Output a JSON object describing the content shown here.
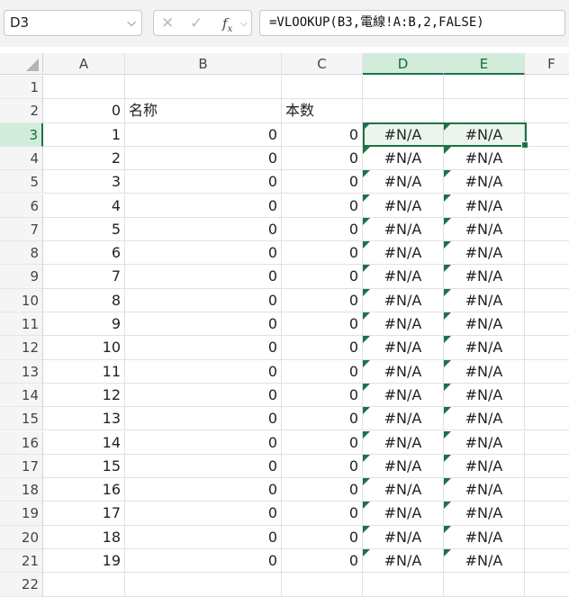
{
  "name_box": "D3",
  "formula": "=VLOOKUP(B3,電線!A:B,2,FALSE)",
  "columns": [
    "A",
    "B",
    "C",
    "D",
    "E",
    "F"
  ],
  "rows": [
    {
      "num": "1",
      "a": "",
      "b": "",
      "c": "",
      "d": "",
      "e": ""
    },
    {
      "num": "2",
      "a": "0",
      "b": "名称",
      "c": "本数",
      "d": "",
      "e": ""
    },
    {
      "num": "3",
      "a": "1",
      "b": "0",
      "c": "0",
      "d": "#N/A",
      "e": "#N/A"
    },
    {
      "num": "4",
      "a": "2",
      "b": "0",
      "c": "0",
      "d": "#N/A",
      "e": "#N/A"
    },
    {
      "num": "5",
      "a": "3",
      "b": "0",
      "c": "0",
      "d": "#N/A",
      "e": "#N/A"
    },
    {
      "num": "6",
      "a": "4",
      "b": "0",
      "c": "0",
      "d": "#N/A",
      "e": "#N/A"
    },
    {
      "num": "7",
      "a": "5",
      "b": "0",
      "c": "0",
      "d": "#N/A",
      "e": "#N/A"
    },
    {
      "num": "8",
      "a": "6",
      "b": "0",
      "c": "0",
      "d": "#N/A",
      "e": "#N/A"
    },
    {
      "num": "9",
      "a": "7",
      "b": "0",
      "c": "0",
      "d": "#N/A",
      "e": "#N/A"
    },
    {
      "num": "10",
      "a": "8",
      "b": "0",
      "c": "0",
      "d": "#N/A",
      "e": "#N/A"
    },
    {
      "num": "11",
      "a": "9",
      "b": "0",
      "c": "0",
      "d": "#N/A",
      "e": "#N/A"
    },
    {
      "num": "12",
      "a": "10",
      "b": "0",
      "c": "0",
      "d": "#N/A",
      "e": "#N/A"
    },
    {
      "num": "13",
      "a": "11",
      "b": "0",
      "c": "0",
      "d": "#N/A",
      "e": "#N/A"
    },
    {
      "num": "14",
      "a": "12",
      "b": "0",
      "c": "0",
      "d": "#N/A",
      "e": "#N/A"
    },
    {
      "num": "15",
      "a": "13",
      "b": "0",
      "c": "0",
      "d": "#N/A",
      "e": "#N/A"
    },
    {
      "num": "16",
      "a": "14",
      "b": "0",
      "c": "0",
      "d": "#N/A",
      "e": "#N/A"
    },
    {
      "num": "17",
      "a": "15",
      "b": "0",
      "c": "0",
      "d": "#N/A",
      "e": "#N/A"
    },
    {
      "num": "18",
      "a": "16",
      "b": "0",
      "c": "0",
      "d": "#N/A",
      "e": "#N/A"
    },
    {
      "num": "19",
      "a": "17",
      "b": "0",
      "c": "0",
      "d": "#N/A",
      "e": "#N/A"
    },
    {
      "num": "20",
      "a": "18",
      "b": "0",
      "c": "0",
      "d": "#N/A",
      "e": "#N/A"
    },
    {
      "num": "21",
      "a": "19",
      "b": "0",
      "c": "0",
      "d": "#N/A",
      "e": "#N/A"
    },
    {
      "num": "22",
      "a": "",
      "b": "",
      "c": "",
      "d": "",
      "e": ""
    }
  ],
  "icons": {
    "cancel": "close-icon",
    "enter": "check-icon",
    "function": "fx-icon",
    "dropdown": "chevron-down-icon"
  },
  "colors": {
    "accent": "#1e7145",
    "selected_header": "#d2ecdc",
    "error_indicator": "#1e7145"
  }
}
